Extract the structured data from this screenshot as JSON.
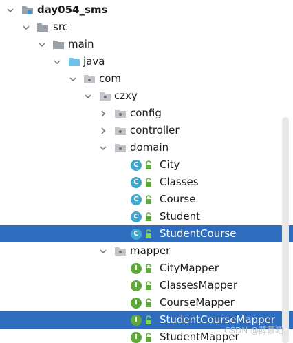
{
  "tree": {
    "root": "day054_sms",
    "src": "src",
    "main": "main",
    "java": "java",
    "com": "com",
    "czxy": "czxy",
    "config": "config",
    "controller": "controller",
    "domain": "domain",
    "domain_classes": [
      "City",
      "Classes",
      "Course",
      "Student",
      "StudentCourse"
    ],
    "mapper": "mapper",
    "mapper_interfaces": [
      "CityMapper",
      "ClassesMapper",
      "CourseMapper",
      "StudentCourseMapper",
      "StudentMapper"
    ]
  },
  "badges": {
    "class": "C",
    "interface": "I"
  },
  "watermark": "CSDN @薛慕昭",
  "colors": {
    "selection": "#2f6ebf",
    "class_badge": "#3ea8cf",
    "interface_badge": "#5fa83a",
    "folder": "#9aa1a8",
    "source_folder": "#6ec2e8"
  }
}
